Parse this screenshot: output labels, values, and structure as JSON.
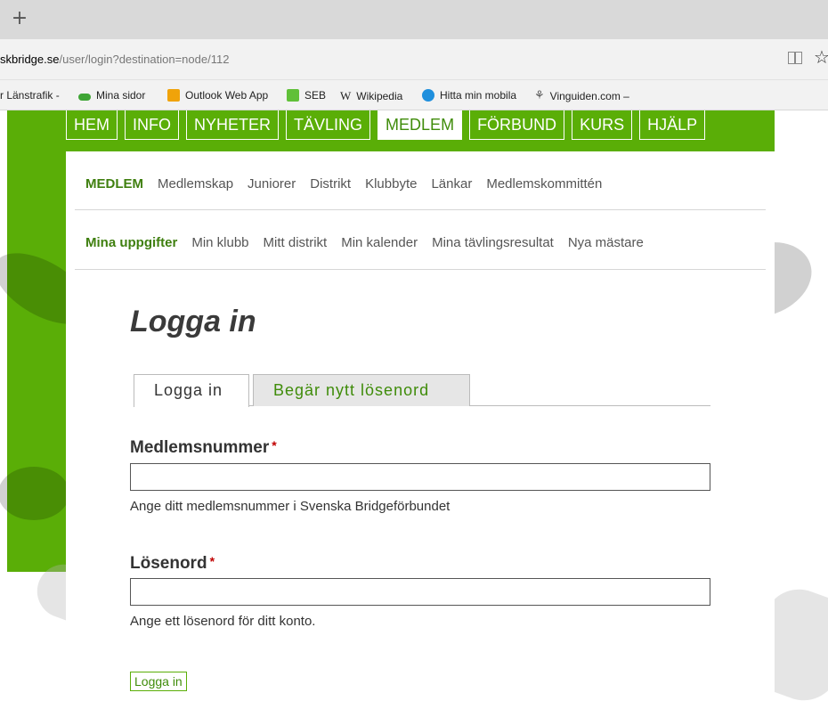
{
  "browser": {
    "new_tab_symbol": "+",
    "url_host": "skbridge.se",
    "url_path": "/user/login?destination=node/112",
    "star_symbol": "☆",
    "favorites": [
      {
        "label": "r Länstrafik -",
        "icon": "none"
      },
      {
        "label": "Mina sidor",
        "icon": "green-pill-icon",
        "color": "#3fa535"
      },
      {
        "label": "Outlook Web App",
        "icon": "outlook-icon",
        "color": "#f0a30a"
      },
      {
        "label": "SEB",
        "icon": "seb-icon",
        "color": "#60c038"
      },
      {
        "label": "Wikipedia",
        "icon": "wikipedia-icon",
        "glyph": "W"
      },
      {
        "label": "Hitta min mobila",
        "icon": "globe-icon",
        "color": "#1f8fdd"
      },
      {
        "label": "Vinguiden.com –",
        "icon": "vinguiden-icon",
        "glyph": "⚘"
      }
    ]
  },
  "main_nav": {
    "items": [
      "HEM",
      "INFO",
      "NYHETER",
      "TÄVLING",
      "MEDLEM",
      "FÖRBUND",
      "KURS",
      "HJÄLP"
    ],
    "active": "MEDLEM"
  },
  "sub_nav_1": {
    "items": [
      "MEDLEM",
      "Medlemskap",
      "Juniorer",
      "Distrikt",
      "Klubbyte",
      "Länkar",
      "Medlemskommittén"
    ],
    "active": "MEDLEM"
  },
  "sub_nav_2": {
    "items": [
      "Mina uppgifter",
      "Min klubb",
      "Mitt distrikt",
      "Min kalender",
      "Mina tävlingsresultat",
      "Nya mästare"
    ],
    "active": "Mina uppgifter"
  },
  "page": {
    "title": "Logga in",
    "tabs": [
      {
        "label": "Logga in",
        "active": true
      },
      {
        "label": "Begär nytt lösenord",
        "active": false
      }
    ]
  },
  "form": {
    "member_label": "Medlemsnummer",
    "member_value": "",
    "member_description": "Ange ditt medlemsnummer i Svenska Bridgeförbundet",
    "password_label": "Lösenord",
    "password_value": "",
    "password_description": "Ange ett lösenord för ditt konto.",
    "required_mark": "*",
    "submit_label": "Logga in"
  },
  "colors": {
    "brand_green": "#5aae07",
    "active_green_text": "#3f8c0a",
    "required_red": "#c00000"
  }
}
